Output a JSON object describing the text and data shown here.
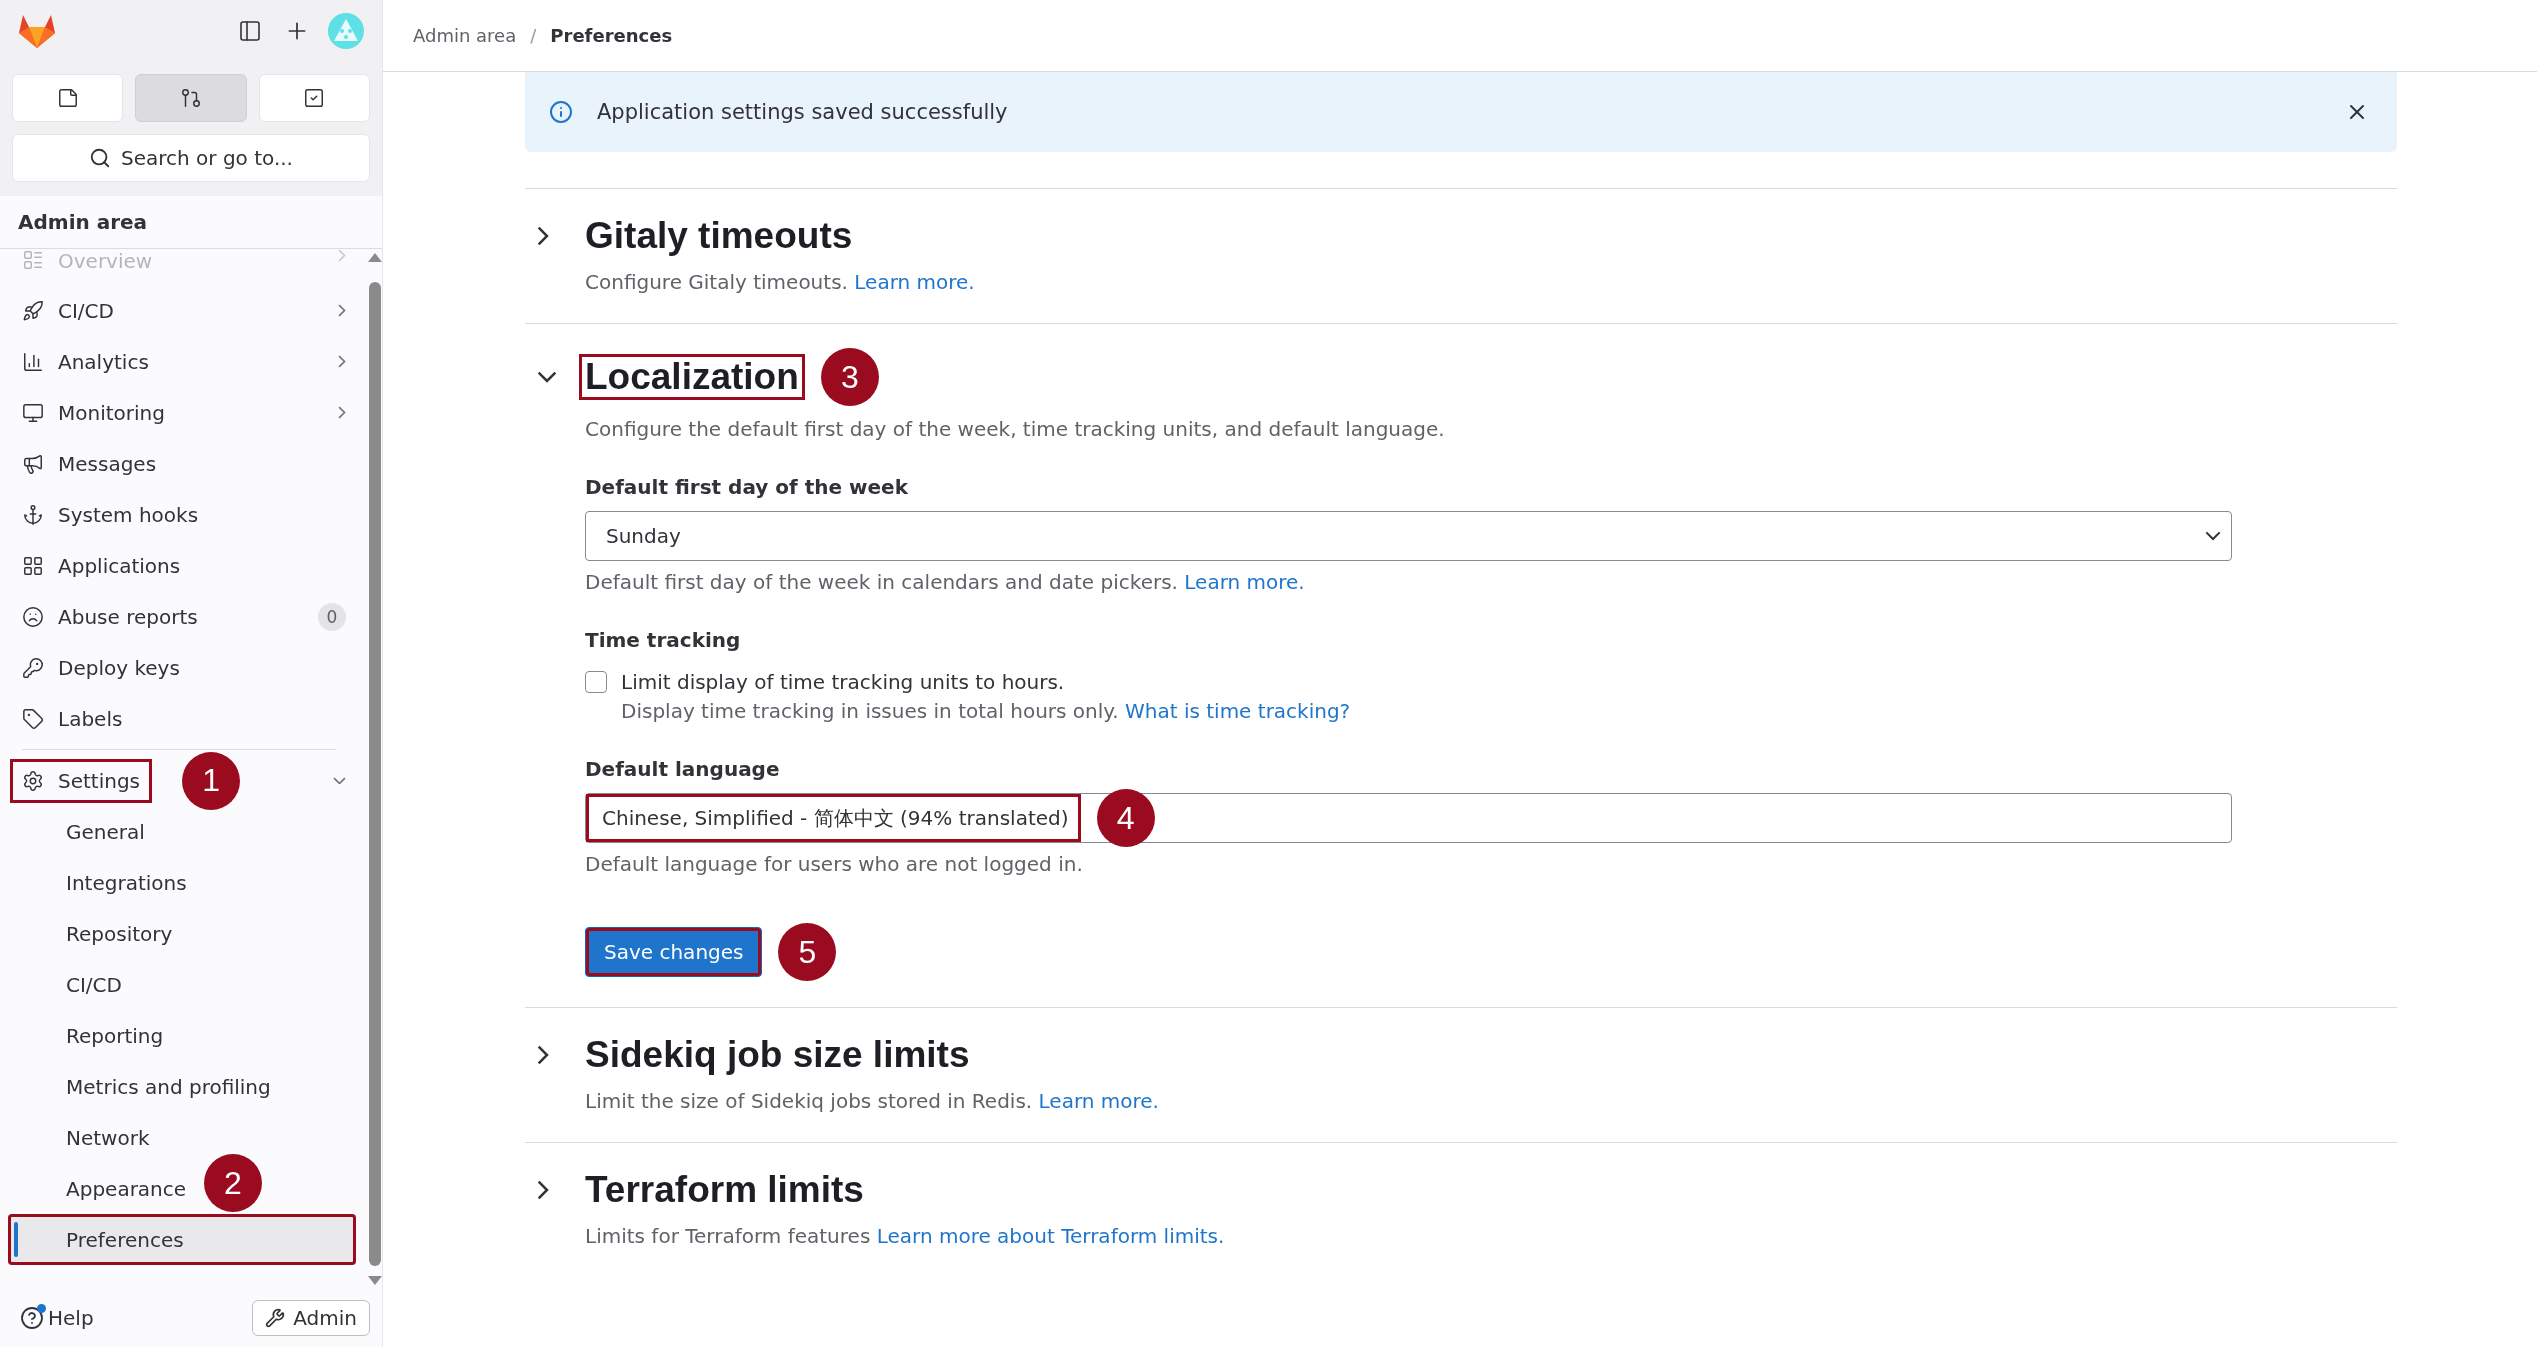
{
  "sidebar": {
    "top_buttons": [
      {
        "kind": "issues",
        "selected": false
      },
      {
        "kind": "merge",
        "selected": true
      },
      {
        "kind": "todo",
        "selected": false
      }
    ],
    "search": {
      "label": "Search or go to..."
    },
    "heading": "Admin area",
    "items": [
      {
        "kind": "overview",
        "label": "Overview",
        "expanded": false
      },
      {
        "kind": "rocket",
        "label": "CI/CD",
        "expanded": false
      },
      {
        "kind": "analytics",
        "label": "Analytics",
        "expanded": false
      },
      {
        "kind": "monitor",
        "label": "Monitoring",
        "expanded": false
      },
      {
        "kind": "megaphone",
        "label": "Messages"
      },
      {
        "kind": "anchor",
        "label": "System hooks"
      },
      {
        "kind": "grid",
        "label": "Applications"
      },
      {
        "kind": "frown",
        "label": "Abuse reports",
        "count": "0"
      },
      {
        "kind": "key",
        "label": "Deploy keys"
      },
      {
        "kind": "tag",
        "label": "Labels"
      },
      {
        "kind": "gear",
        "label": "Settings",
        "expanded": true,
        "callout": "1",
        "children": [
          {
            "label": "General",
            "selected": false
          },
          {
            "label": "Integrations",
            "selected": false
          },
          {
            "label": "Repository",
            "selected": false
          },
          {
            "label": "CI/CD",
            "selected": false
          },
          {
            "label": "Reporting",
            "selected": false
          },
          {
            "label": "Metrics and profiling",
            "selected": false
          },
          {
            "label": "Network",
            "selected": false
          },
          {
            "label": "Appearance",
            "selected": false
          },
          {
            "label": "Preferences",
            "selected": true,
            "callout": "2"
          }
        ]
      }
    ],
    "help": {
      "label": "Help",
      "notification": true
    },
    "admin": {
      "label": "Admin"
    }
  },
  "breadcrumb_separator": "/",
  "breadcrumb": [
    {
      "label": "Admin area",
      "current": false
    },
    {
      "label": "Preferences",
      "current": true
    }
  ],
  "alert": {
    "message": "Application settings saved successfully"
  },
  "sections": [
    {
      "title": "Gitaly timeouts",
      "expanded": false,
      "description": "Configure Gitaly timeouts.",
      "link": "Learn more."
    },
    {
      "title": "Localization",
      "expanded": true,
      "callout": "3",
      "description": "Configure the default first day of the week, time tracking units, and default language.",
      "first_day": {
        "label": "Default first day of the week",
        "value": "Sunday",
        "help": "Default first day of the week in calendars and date pickers.",
        "link": "Learn more."
      },
      "time_tracking": {
        "label": "Time tracking",
        "checkbox": {
          "label": "Limit display of time tracking units to hours.",
          "checked": false
        },
        "help": "Display time tracking in issues in total hours only.",
        "link": "What is time tracking?"
      },
      "language": {
        "label": "Default language",
        "value": "Chinese, Simplified - 简体中文 (94% translated)",
        "callout": "4",
        "help": "Default language for users who are not logged in."
      },
      "save": {
        "label": "Save changes",
        "callout": "5"
      }
    },
    {
      "title": "Sidekiq job size limits",
      "expanded": false,
      "description": "Limit the size of Sidekiq jobs stored in Redis.",
      "link": "Learn more."
    },
    {
      "title": "Terraform limits",
      "expanded": false,
      "description": "Limits for Terraform features",
      "link": "Learn more about Terraform limits."
    }
  ]
}
